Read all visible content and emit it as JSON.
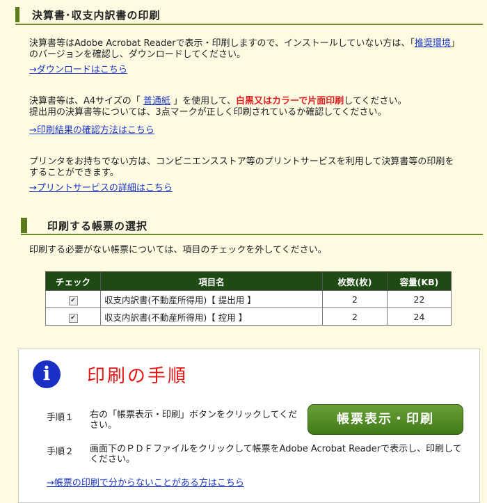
{
  "section1": {
    "title": "決算書･収支内訳書の印刷",
    "install_text_pre": "決算書等はAdobe Acrobat Readerで表示・印刷しますので、インストールしていない方は、「",
    "install_link": "推奨環境",
    "install_text_post": "」のバージョンを確認し、ダウンロードしてください。",
    "download_link": "→ダウンロードはこちら",
    "paper_text_pre": "決算書等は、A4サイズの「 ",
    "paper_link": "普通紙",
    "paper_text_mid": " 」を使用して、",
    "paper_text_red": "白黒又はカラーで片面印刷",
    "paper_text_post": "してください。",
    "paper_text_line2": "提出用の決算書等については、3点マークが正しく印刷されているか確認してください。",
    "confirm_link": "→印刷結果の確認方法はこちら",
    "printer_text": "プリンタをお持ちでない方は、コンビニエンスストア等のプリントサービスを利用して決算書等の印刷をすることができます。",
    "print_service_link": "→プリントサービスの詳細はこちら"
  },
  "section2": {
    "title": "印刷する帳票の選択",
    "instruction": "印刷する必要がない帳票については、項目のチェックを外してください。",
    "columns": [
      "チェック",
      "項目名",
      "枚数(枚)",
      "容量(KB)"
    ],
    "rows": [
      {
        "checked": true,
        "name": "収支内訳書(不動産所得用)【 提出用 】",
        "pages": "2",
        "size": "22"
      },
      {
        "checked": true,
        "name": "収支内訳書(不動産所得用)【 控用 】",
        "pages": "2",
        "size": "24"
      }
    ]
  },
  "procedure": {
    "icon": "info-icon",
    "icon_glyph": "i",
    "title": "印刷の手順",
    "step1_label": "手順１",
    "step1_text": "右の「帳票表示・印刷」ボタンをクリックしてください。",
    "button_label": "帳票表示・印刷",
    "step2_label": "手順２",
    "step2_text": "画面下のＰＤＦファイルをクリックして帳票をAdobe Acrobat Readerで表示し、印刷してください。",
    "help_link": "→帳票の印刷で分からないことがある方はこちら"
  },
  "colors": {
    "background": "#fffbe3",
    "accent_green": "#5a7a1c",
    "table_header": "#1e4a14",
    "button": "#4f8a22",
    "title_red": "#e51414",
    "link": "#1a37c8"
  }
}
